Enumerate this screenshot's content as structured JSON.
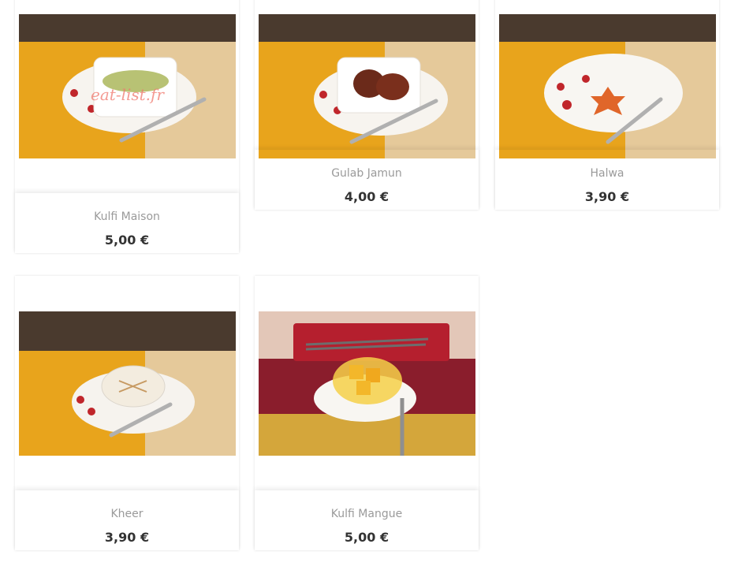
{
  "products": [
    {
      "name": "Kulfi Maison",
      "price": "5,00 €",
      "watermark": "eat-list.fr"
    },
    {
      "name": "Gulab Jamun",
      "price": "4,00 €"
    },
    {
      "name": "Halwa",
      "price": "3,90 €"
    },
    {
      "name": "Kheer",
      "price": "3,90 €"
    },
    {
      "name": "Kulfi Mangue",
      "price": "5,00 €"
    }
  ],
  "colors": {
    "name_text": "#9a9a9a",
    "price_text": "#333333",
    "placemat_yellow": "#e8a41c",
    "table_wood": "#e5c99a",
    "wall_dark": "#4a3a2e"
  }
}
